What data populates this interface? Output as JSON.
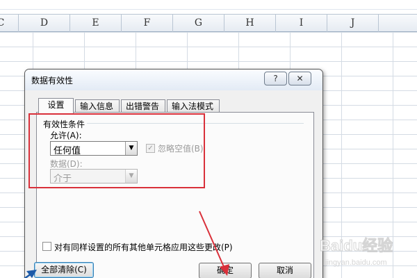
{
  "sheet": {
    "columns": [
      "C",
      "D",
      "E",
      "F",
      "G",
      "H",
      "I",
      "J"
    ]
  },
  "dialog": {
    "title": "数据有效性",
    "help_glyph": "?",
    "close_glyph": "✕",
    "tabs": [
      {
        "label": "设置",
        "active": true
      },
      {
        "label": "输入信息",
        "active": false
      },
      {
        "label": "出错警告",
        "active": false
      },
      {
        "label": "输入法模式",
        "active": false
      }
    ],
    "validation_group": {
      "title": "有效性条件",
      "allow_label": "允许(A):",
      "allow_value": "任何值",
      "ignore_blank_label": "忽略空值(B)",
      "ignore_blank_checked": true,
      "ignore_blank_enabled": false,
      "data_label": "数据(D):",
      "data_value": "介于",
      "data_enabled": false
    },
    "apply_all_label": "对有同样设置的所有其他单元格应用这些更改(P)",
    "apply_all_checked": false,
    "buttons": {
      "clear_all": "全部清除(C)",
      "ok": "确定",
      "cancel": "取消"
    }
  },
  "annotations": {
    "highlight_color": "#d9303a",
    "arrow_color": "#d9303a"
  },
  "watermark": {
    "text": "Baidu经验",
    "subtext": "jingyan.baidu.com"
  }
}
